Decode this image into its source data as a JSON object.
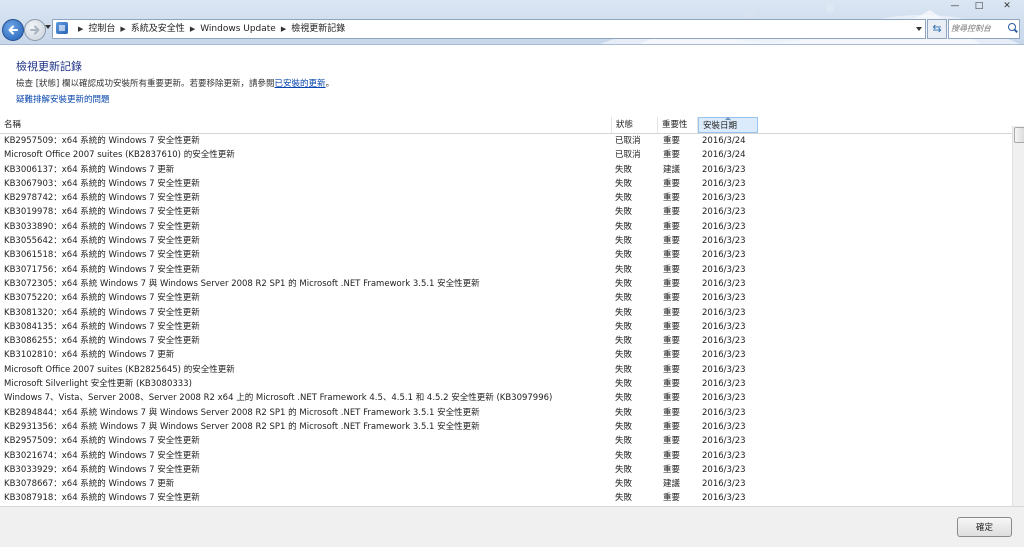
{
  "window": {
    "minimize_glyph": "—",
    "maximize_glyph": "□",
    "close_glyph": "✕"
  },
  "address": {
    "crumbs": [
      "控制台",
      "系統及安全性",
      "Windows Update",
      "檢視更新記錄"
    ],
    "search_placeholder": "搜尋控制台"
  },
  "page": {
    "title": "檢視更新記錄",
    "desc_pre": "檢查 [狀態] 欄以確認成功安裝所有重要更新。若要移除更新，請參閱",
    "desc_link": "已安裝的更新",
    "desc_post": "。",
    "trouble_link": "疑難排解安裝更新的問題"
  },
  "columns": {
    "name": "名稱",
    "status": "狀態",
    "importance": "重要性",
    "date": "安裝日期"
  },
  "updates": [
    {
      "name": "KB2957509：x64 系統的 Windows 7 安全性更新",
      "status": "已取消",
      "importance": "重要",
      "date": "2016/3/24"
    },
    {
      "name": "Microsoft Office 2007 suites (KB2837610) 的安全性更新",
      "status": "已取消",
      "importance": "重要",
      "date": "2016/3/24"
    },
    {
      "name": "KB3006137：x64 系統的 Windows 7 更新",
      "status": "失敗",
      "importance": "建議",
      "date": "2016/3/23"
    },
    {
      "name": "KB3067903：x64 系統的 Windows 7 安全性更新",
      "status": "失敗",
      "importance": "重要",
      "date": "2016/3/23"
    },
    {
      "name": "KB2978742：x64 系統的 Windows 7 安全性更新",
      "status": "失敗",
      "importance": "重要",
      "date": "2016/3/23"
    },
    {
      "name": "KB3019978：x64 系統的 Windows 7 安全性更新",
      "status": "失敗",
      "importance": "重要",
      "date": "2016/3/23"
    },
    {
      "name": "KB3033890：x64 系統的 Windows 7 安全性更新",
      "status": "失敗",
      "importance": "重要",
      "date": "2016/3/23"
    },
    {
      "name": "KB3055642：x64 系統的 Windows 7 安全性更新",
      "status": "失敗",
      "importance": "重要",
      "date": "2016/3/23"
    },
    {
      "name": "KB3061518：x64 系統的 Windows 7 安全性更新",
      "status": "失敗",
      "importance": "重要",
      "date": "2016/3/23"
    },
    {
      "name": "KB3071756：x64 系統的 Windows 7 安全性更新",
      "status": "失敗",
      "importance": "重要",
      "date": "2016/3/23"
    },
    {
      "name": "KB3072305：x64 系統 Windows 7 與 Windows Server 2008 R2 SP1 的 Microsoft .NET Framework 3.5.1 安全性更新",
      "status": "失敗",
      "importance": "重要",
      "date": "2016/3/23"
    },
    {
      "name": "KB3075220：x64 系統的 Windows 7 安全性更新",
      "status": "失敗",
      "importance": "重要",
      "date": "2016/3/23"
    },
    {
      "name": "KB3081320：x64 系統的 Windows 7 安全性更新",
      "status": "失敗",
      "importance": "重要",
      "date": "2016/3/23"
    },
    {
      "name": "KB3084135：x64 系統的 Windows 7 安全性更新",
      "status": "失敗",
      "importance": "重要",
      "date": "2016/3/23"
    },
    {
      "name": "KB3086255：x64 系統的 Windows 7 安全性更新",
      "status": "失敗",
      "importance": "重要",
      "date": "2016/3/23"
    },
    {
      "name": "KB3102810：x64 系統的 Windows 7 更新",
      "status": "失敗",
      "importance": "重要",
      "date": "2016/3/23"
    },
    {
      "name": "Microsoft Office 2007 suites (KB2825645) 的安全性更新",
      "status": "失敗",
      "importance": "重要",
      "date": "2016/3/23"
    },
    {
      "name": "Microsoft Silverlight 安全性更新 (KB3080333)",
      "status": "失敗",
      "importance": "重要",
      "date": "2016/3/23"
    },
    {
      "name": "Windows 7、Vista、Server 2008、Server 2008 R2 x64 上的 Microsoft .NET Framework 4.5、4.5.1 和 4.5.2 安全性更新 (KB3097996)",
      "status": "失敗",
      "importance": "重要",
      "date": "2016/3/23"
    },
    {
      "name": "KB2894844：x64 系統 Windows 7 與 Windows Server 2008 R2 SP1 的 Microsoft .NET Framework 3.5.1 安全性更新",
      "status": "失敗",
      "importance": "重要",
      "date": "2016/3/23"
    },
    {
      "name": "KB2931356：x64 系統 Windows 7 與 Windows Server 2008 R2 SP1 的 Microsoft .NET Framework 3.5.1 安全性更新",
      "status": "失敗",
      "importance": "重要",
      "date": "2016/3/23"
    },
    {
      "name": "KB2957509：x64 系統的 Windows 7 安全性更新",
      "status": "失敗",
      "importance": "重要",
      "date": "2016/3/23"
    },
    {
      "name": "KB3021674：x64 系統的 Windows 7 安全性更新",
      "status": "失敗",
      "importance": "重要",
      "date": "2016/3/23"
    },
    {
      "name": "KB3033929：x64 系統的 Windows 7 安全性更新",
      "status": "失敗",
      "importance": "重要",
      "date": "2016/3/23"
    },
    {
      "name": "KB3078667：x64 系統的 Windows 7 更新",
      "status": "失敗",
      "importance": "建議",
      "date": "2016/3/23"
    },
    {
      "name": "KB3087918：x64 系統的 Windows 7 安全性更新",
      "status": "失敗",
      "importance": "重要",
      "date": "2016/3/23"
    }
  ],
  "footer": {
    "ok_label": "確定"
  }
}
